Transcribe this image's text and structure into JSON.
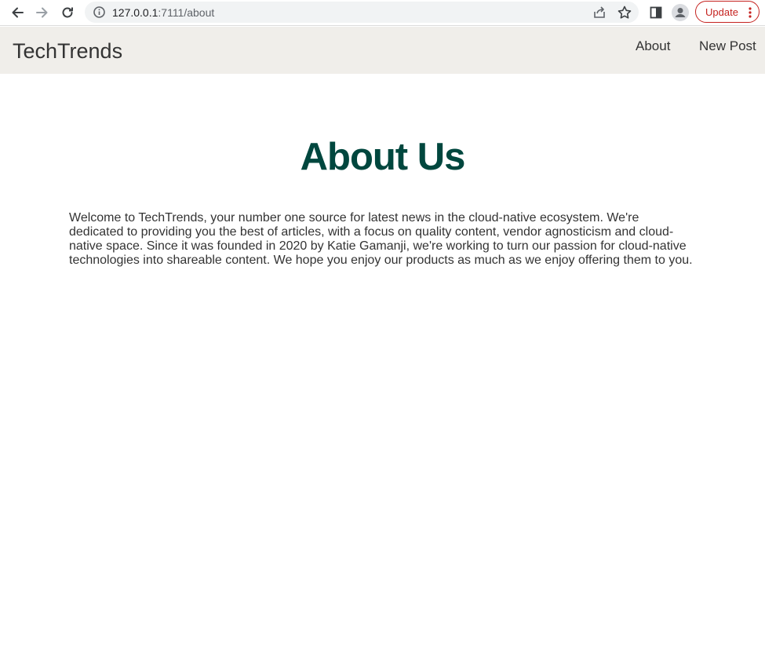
{
  "browser": {
    "url_host": "127.0.0.1",
    "url_path": ":7111/about",
    "update_label": "Update",
    "icons": {
      "back": "back-arrow-icon",
      "forward": "forward-arrow-icon",
      "reload": "reload-icon",
      "info": "info-icon",
      "share": "share-icon",
      "bookmark": "star-icon",
      "sidepanel": "side-panel-icon",
      "profile": "profile-icon",
      "menu": "more-vert-icon"
    },
    "accent_color": "#c5221f"
  },
  "site": {
    "brand": "TechTrends",
    "nav": [
      {
        "label": "About"
      },
      {
        "label": "New Post"
      }
    ],
    "navbar_color": "#f0eeea"
  },
  "main": {
    "title": "About Us",
    "title_color": "#00473e",
    "body": "Welcome to TechTrends, your number one source for latest news in the cloud-native ecosystem. We're dedicated to providing you the best of articles, with a focus on quality content, vendor agnosticism and cloud-native space. Since it was founded in 2020 by Katie Gamanji, we're working to turn our passion for cloud-native technologies into shareable content. We hope you enjoy our products as much as we enjoy offering them to you."
  }
}
